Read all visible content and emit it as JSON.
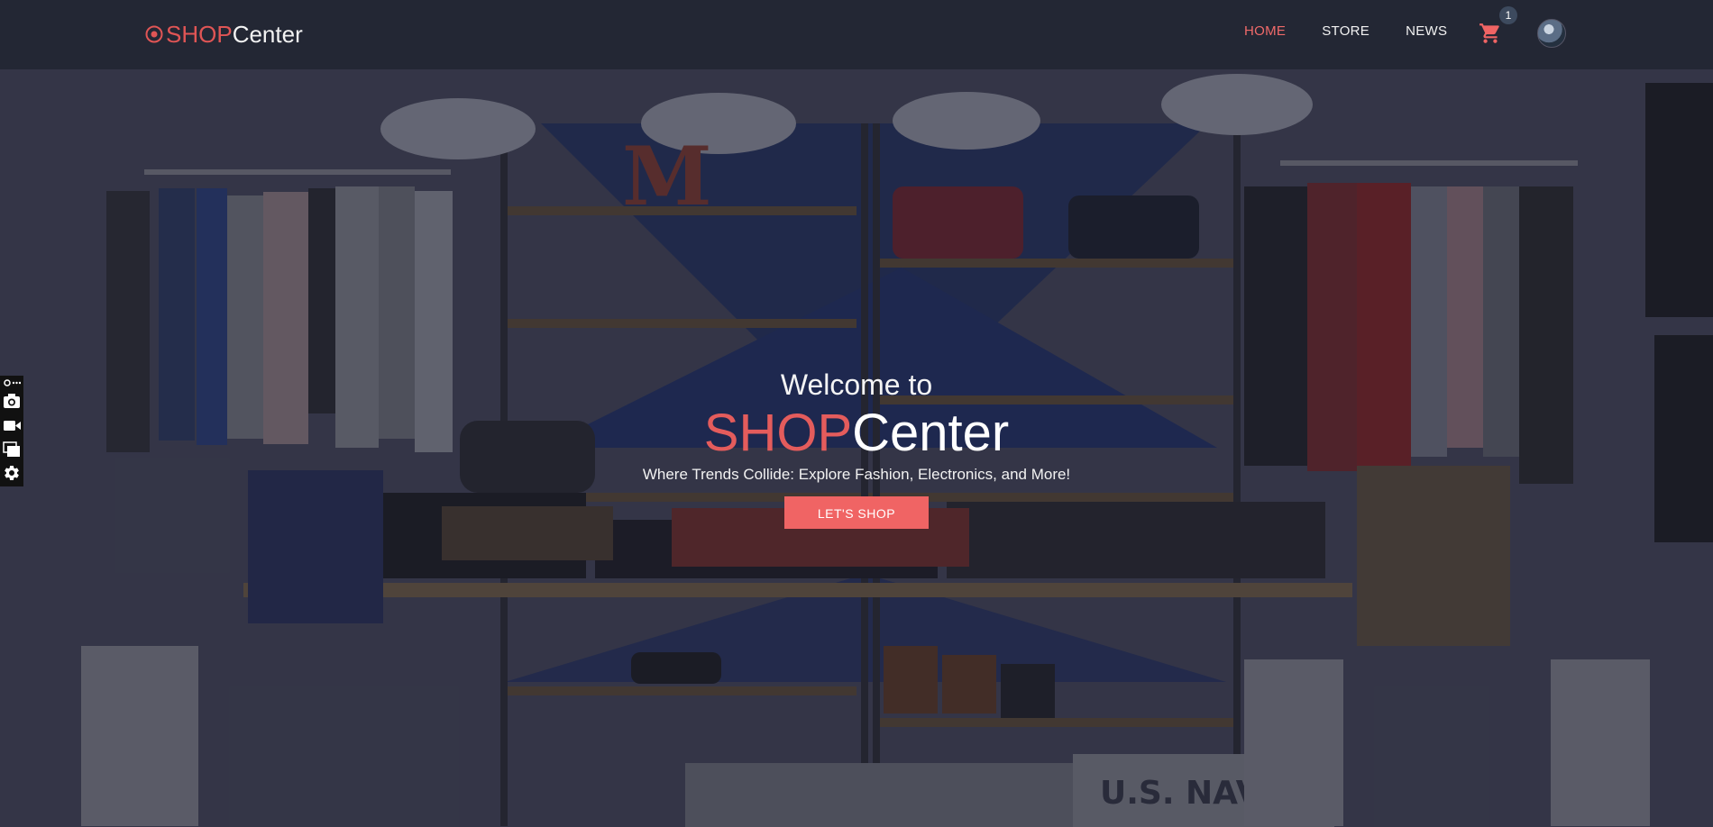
{
  "brand": {
    "part1": "SHOP",
    "part2": "Center",
    "icon": "target-icon"
  },
  "nav": {
    "items": [
      {
        "label": "HOME",
        "active": true
      },
      {
        "label": "STORE",
        "active": false
      },
      {
        "label": "NEWS",
        "active": false
      }
    ],
    "cart": {
      "icon": "cart-icon",
      "count": "1"
    },
    "avatar": {
      "icon": "user-avatar"
    }
  },
  "hero": {
    "welcome": "Welcome to",
    "title_part1": "SHOP",
    "title_part2": "Center",
    "tagline": "Where Trends Collide: Explore Fashion, Electronics, and More!",
    "cta_label": "LET'S SHOP",
    "background": "clothing store interior photo"
  },
  "side_toolbar": {
    "tools": [
      "link-more-icon",
      "camera-icon",
      "video-icon",
      "screens-icon",
      "gear-icon"
    ]
  },
  "colors": {
    "accent": "#f06464",
    "brand_red": "#e05555",
    "navbar": "#232734",
    "badge": "#3d4a5e"
  }
}
